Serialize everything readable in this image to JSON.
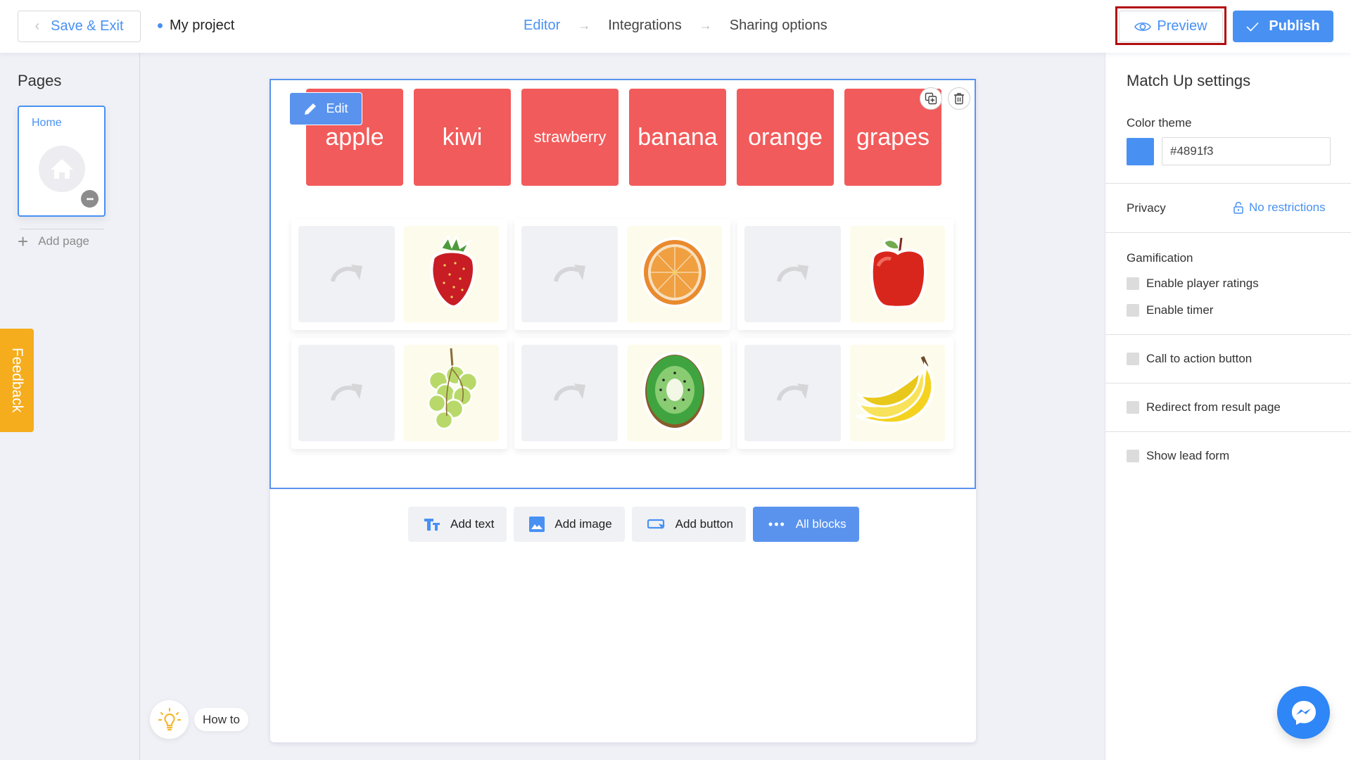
{
  "header": {
    "save_exit_label": "Save & Exit",
    "project_name": "My project",
    "steps": [
      {
        "label": "Editor",
        "active": true
      },
      {
        "label": "Integrations",
        "active": false
      },
      {
        "label": "Sharing options",
        "active": false
      }
    ],
    "preview_label": "Preview",
    "publish_label": "Publish"
  },
  "sidebar": {
    "title": "Pages",
    "pages": [
      {
        "name": "Home"
      }
    ],
    "add_page_label": "Add page",
    "feedback_label": "Feedback"
  },
  "canvas": {
    "edit_label": "Edit",
    "tiles": [
      "apple",
      "kiwi",
      "strawberry",
      "banana",
      "orange",
      "grapes"
    ],
    "pairs": [
      {
        "image": "strawberry"
      },
      {
        "image": "orange"
      },
      {
        "image": "apple"
      },
      {
        "image": "grapes"
      },
      {
        "image": "kiwi"
      },
      {
        "image": "banana"
      }
    ],
    "add_blocks": [
      {
        "label": "Add text",
        "icon": "text-icon"
      },
      {
        "label": "Add image",
        "icon": "image-icon"
      },
      {
        "label": "Add button",
        "icon": "button-icon"
      },
      {
        "label": "All blocks",
        "icon": "more-icon"
      }
    ],
    "how_to_label": "How to"
  },
  "settings": {
    "title": "Match Up settings",
    "color_theme_label": "Color theme",
    "color_theme_value": "#4891f3",
    "privacy_label": "Privacy",
    "privacy_value": "No restrictions",
    "gamification_label": "Gamification",
    "options": [
      {
        "label": "Enable player ratings",
        "checked": false
      },
      {
        "label": "Enable timer",
        "checked": false
      },
      {
        "label": "Call to action button",
        "checked": false
      },
      {
        "label": "Redirect from result page",
        "checked": false
      },
      {
        "label": "Show lead form",
        "checked": false
      }
    ]
  },
  "colors": {
    "accent": "#4891f3",
    "tile": "#f25b5b",
    "feedback": "#f5ad1e",
    "preview_highlight": "#b10e12"
  }
}
